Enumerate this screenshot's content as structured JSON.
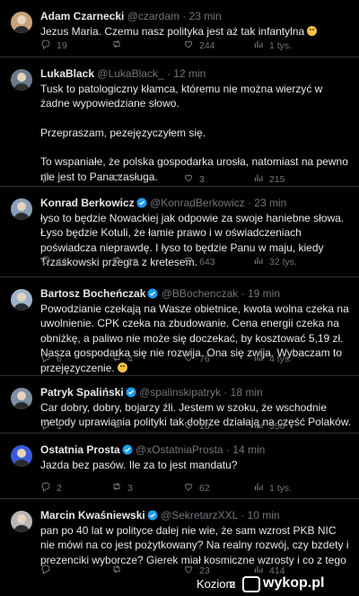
{
  "tweets": [
    {
      "name": "Adam Czarnecki",
      "handle": "@czardam",
      "time": "23 min",
      "text": [
        "Jezus Maria. Czemu nasz polityka jest aż tak infantylna"
      ],
      "emoji": true,
      "replies": "19",
      "retweets": "",
      "likes": "244",
      "views": "1 tys."
    },
    {
      "name": "LukaBlack",
      "handle": "@LukaBlack_",
      "time": "12 min",
      "text": [
        "Tusk to patologiczny kłamca, któremu nie można wierzyć w żadne wypowiedziane słowo.",
        "Przepraszam, pezejęzyczyłem się.",
        "To wspaniałe, że polska gospodarka urosła, natomiast na pewno nie jest to Pana zasługa."
      ],
      "replies": "1",
      "retweets": "",
      "likes": "3",
      "views": "215"
    },
    {
      "name": "Konrad Berkowicz",
      "handle": "@KonradBerkowicz",
      "time": "23 min",
      "text": [
        "łyso to będzie Nowackiej jak odpowie za swoje haniebne słowa. Łyso będzie Kotuli, że łamie prawo i w oświadczeniach poświadcza nieprawdę. I łyso to będzie Panu w maju, kiedy Trzaskowski przegra z kretesem."
      ],
      "replies": "46",
      "retweets": "28",
      "likes": "643",
      "views": "32 tys."
    },
    {
      "name": "Bartosz Bocheńczak",
      "handle": "@BBochenczak",
      "time": "19 min",
      "text": [
        "Powodzianie czekają na Wasze obietnice, kwota wolna czeka na uwolnienie. CPK czeka na zbudowanie. Cena energii czeka na obniżkę, a paliwo nie może się doczekać, by kosztować 5,19 zł. Nasza gospodarka się nie rozwija. Ona się zwija. Wybaczam to przejęzyczenie."
      ],
      "emoji": true,
      "replies": "6",
      "retweets": "4",
      "likes": "76",
      "views": "4 tys."
    },
    {
      "name": "Patryk Spaliński",
      "handle": "@spalinskipatryk",
      "time": "18 min",
      "text": [
        "Car dobry, dobry, bojarzy źli. Jestem w szoku, że wschodnie metody uprawiania polityki tak dobrze działają na część Polaków."
      ],
      "replies": "1",
      "retweets": "",
      "likes": "16",
      "views": "350"
    },
    {
      "name": "Ostatnia Prosta",
      "handle": "@xOstatniaProsta",
      "time": "14 min",
      "text": [
        "Jazda bez pasów. Ile za to jest mandatu?"
      ],
      "replies": "2",
      "retweets": "3",
      "likes": "62",
      "views": "1 tys."
    },
    {
      "name": "Marcin Kwaśniewski",
      "handle": "@SekretarzXXL",
      "time": "10 min",
      "text": [
        "pan po 40 lat w polityce dalej nie wie, że sam wzrost PKB NIC nie mówi na co jest pożytkowany?  Na realny rozwój, czy bzdety i prezenciki wyborcze? Gierek miał kosmiczne wzrosty i co z tego"
      ],
      "replies": "",
      "retweets": "",
      "likes": "23",
      "views": "414"
    }
  ],
  "watermark": {
    "site": "Koziom",
    "z": "z",
    "brand": "wykop.pl"
  }
}
